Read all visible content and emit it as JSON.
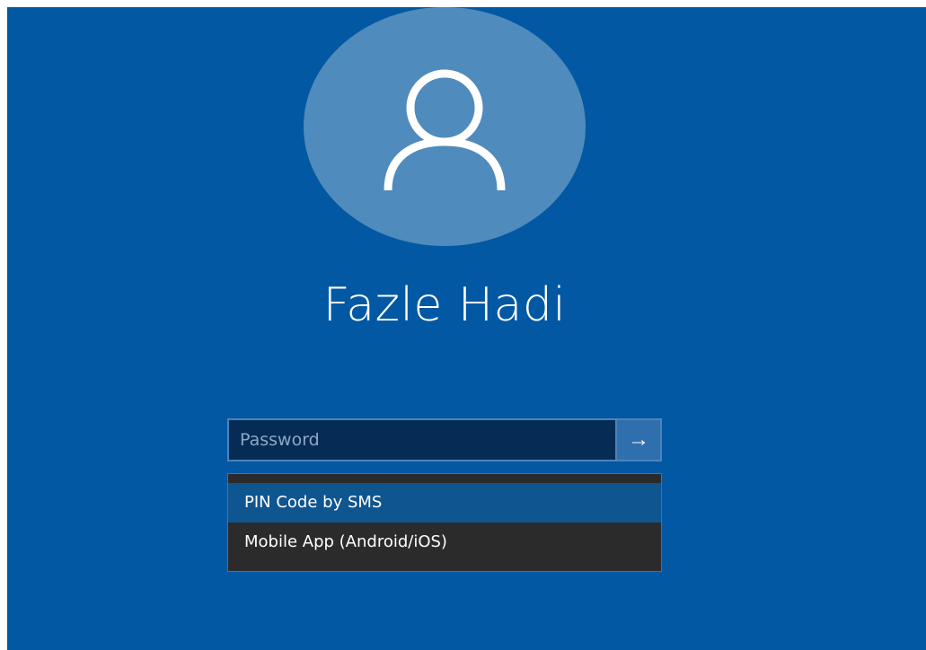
{
  "user": {
    "name": "Fazle Hadi",
    "avatar_icon": "user-icon"
  },
  "login": {
    "password_placeholder": "Password",
    "password_value": "",
    "submit_icon": "arrow-right-icon",
    "submit_glyph": "→"
  },
  "auth_options": {
    "selected_index": 0,
    "items": [
      {
        "label": "PIN Code by SMS"
      },
      {
        "label": "Mobile App (Android/iOS)"
      }
    ]
  },
  "colors": {
    "background": "#0258a3",
    "avatar": "#4f8bbc",
    "input_bg": "#052c55",
    "menu_bg": "#2b2b2b",
    "menu_selected": "#0f5590"
  }
}
